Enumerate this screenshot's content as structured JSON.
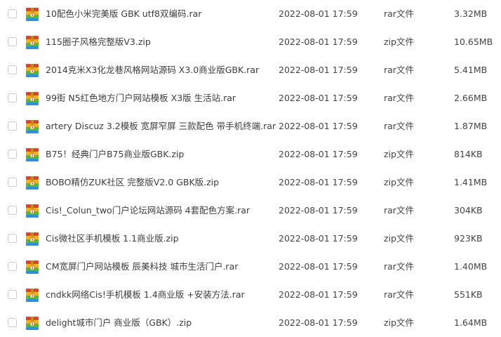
{
  "files": [
    {
      "name": "10配色小米完美版 GBK utf8双编码.rar",
      "date": "2022-08-01 17:59",
      "type": "rar文件",
      "size": "3.32MB",
      "icon": "archive-icon"
    },
    {
      "name": "115圈子风格完整版V3.zip",
      "date": "2022-08-01 17:59",
      "type": "zip文件",
      "size": "10.65MB",
      "icon": "archive-icon"
    },
    {
      "name": "2014克米X3化龙巷风格网站源码 X3.0商业版GBK.rar",
      "date": "2022-08-01 17:59",
      "type": "rar文件",
      "size": "5.41MB",
      "icon": "archive-icon"
    },
    {
      "name": "99街 N5红色地方门户网站模板 X3版 生活站.rar",
      "date": "2022-08-01 17:59",
      "type": "rar文件",
      "size": "2.66MB",
      "icon": "archive-icon"
    },
    {
      "name": "artery Discuz 3.2模板 宽屏窄屏 三款配色 带手机终端.rar",
      "date": "2022-08-01 17:59",
      "type": "rar文件",
      "size": "1.87MB",
      "icon": "archive-icon"
    },
    {
      "name": "B75！经典门户B75商业版GBK.zip",
      "date": "2022-08-01 17:59",
      "type": "zip文件",
      "size": "814KB",
      "icon": "archive-icon"
    },
    {
      "name": "BOBO精仿ZUK社区 完整版V2.0 GBK版.zip",
      "date": "2022-08-01 17:59",
      "type": "zip文件",
      "size": "1.41MB",
      "icon": "archive-icon"
    },
    {
      "name": "Cis!_Colun_two门户论坛网站源码 4套配色方案.rar",
      "date": "2022-08-01 17:59",
      "type": "rar文件",
      "size": "304KB",
      "icon": "archive-icon"
    },
    {
      "name": "Cis微社区手机模板 1.1商业版.zip",
      "date": "2022-08-01 17:59",
      "type": "zip文件",
      "size": "923KB",
      "icon": "archive-icon"
    },
    {
      "name": "CM宽屏门户网站模板 辰美科技 城市生活门户.rar",
      "date": "2022-08-01 17:59",
      "type": "rar文件",
      "size": "1.40MB",
      "icon": "archive-icon"
    },
    {
      "name": "cndkk网络Cis!手机模板 1.4商业版 +安装方法.rar",
      "date": "2022-08-01 17:59",
      "type": "rar文件",
      "size": "551KB",
      "icon": "archive-icon"
    },
    {
      "name": "delight城市门户 商业版（GBK）.zip",
      "date": "2022-08-01 17:59",
      "type": "zip文件",
      "size": "1.64MB",
      "icon": "archive-icon"
    }
  ],
  "colors": {
    "text": "#3d3d3d",
    "checkbox_border": "#c9c9c9",
    "icon_red": "#e2412f",
    "icon_yellow": "#f4b41f",
    "icon_green": "#5bb432",
    "icon_blue": "#2d8fdd",
    "icon_zipper": "#d98a1a"
  }
}
